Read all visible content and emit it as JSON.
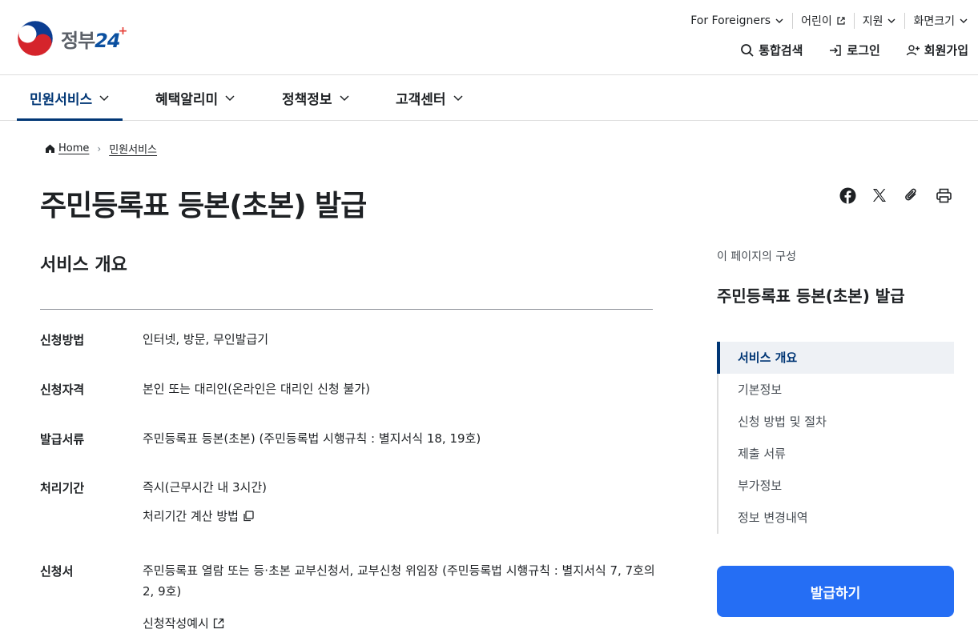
{
  "header": {
    "logo_text": "정부",
    "logo_num": "24",
    "util_links": [
      {
        "label": "For Foreigners",
        "icon": "chevron-down-icon"
      },
      {
        "label": "어린이",
        "icon": "external-link-icon"
      },
      {
        "label": "지원",
        "icon": "chevron-down-icon"
      },
      {
        "label": "화면크기",
        "icon": "chevron-down-icon"
      }
    ],
    "actions": [
      {
        "label": "통합검색",
        "icon": "search-icon"
      },
      {
        "label": "로그인",
        "icon": "login-icon"
      },
      {
        "label": "회원가입",
        "icon": "user-plus-icon"
      }
    ]
  },
  "gnb": [
    {
      "label": "민원서비스",
      "active": true
    },
    {
      "label": "혜택알리미",
      "active": false
    },
    {
      "label": "정책정보",
      "active": false
    },
    {
      "label": "고객센터",
      "active": false
    }
  ],
  "breadcrumb": {
    "home": "Home",
    "current": "민원서비스"
  },
  "page_title": "주민등록표 등본(초본) 발급",
  "share_tools": [
    "facebook-icon",
    "x-icon",
    "link-clip-icon",
    "print-icon"
  ],
  "overview": {
    "title": "서비스 개요",
    "rows": [
      {
        "label": "신청방법",
        "value": "인터넷, 방문, 무인발급기"
      },
      {
        "label": "신청자격",
        "value": "본인 또는 대리인(온라인은 대리인 신청 불가)"
      },
      {
        "label": "발급서류",
        "value": "주민등록표 등본(초본) (주민등록법 시행규칙 : 별지서식 18, 19호)"
      },
      {
        "label": "처리기간",
        "value": "즉시(근무시간 내 3시간)",
        "link": "처리기간 계산 방법"
      },
      {
        "label": "신청서",
        "value": "주민등록표 열람 또는 등·초본 교부신청서, 교부신청 위임장 (주민등록법 시행규칙 : 별지서식 7, 7호의2, 9호)",
        "link": "신청작성예시"
      }
    ]
  },
  "toc": {
    "caption": "이 페이지의 구성",
    "title": "주민등록표 등본(초본) 발급",
    "items": [
      "서비스 개요",
      "기본정보",
      "신청 방법 및 절차",
      "제출 서류",
      "부가정보",
      "정보 변경내역"
    ]
  },
  "issue_button": "발급하기",
  "colors": {
    "primary": "#256ef4",
    "navy": "#003675"
  }
}
